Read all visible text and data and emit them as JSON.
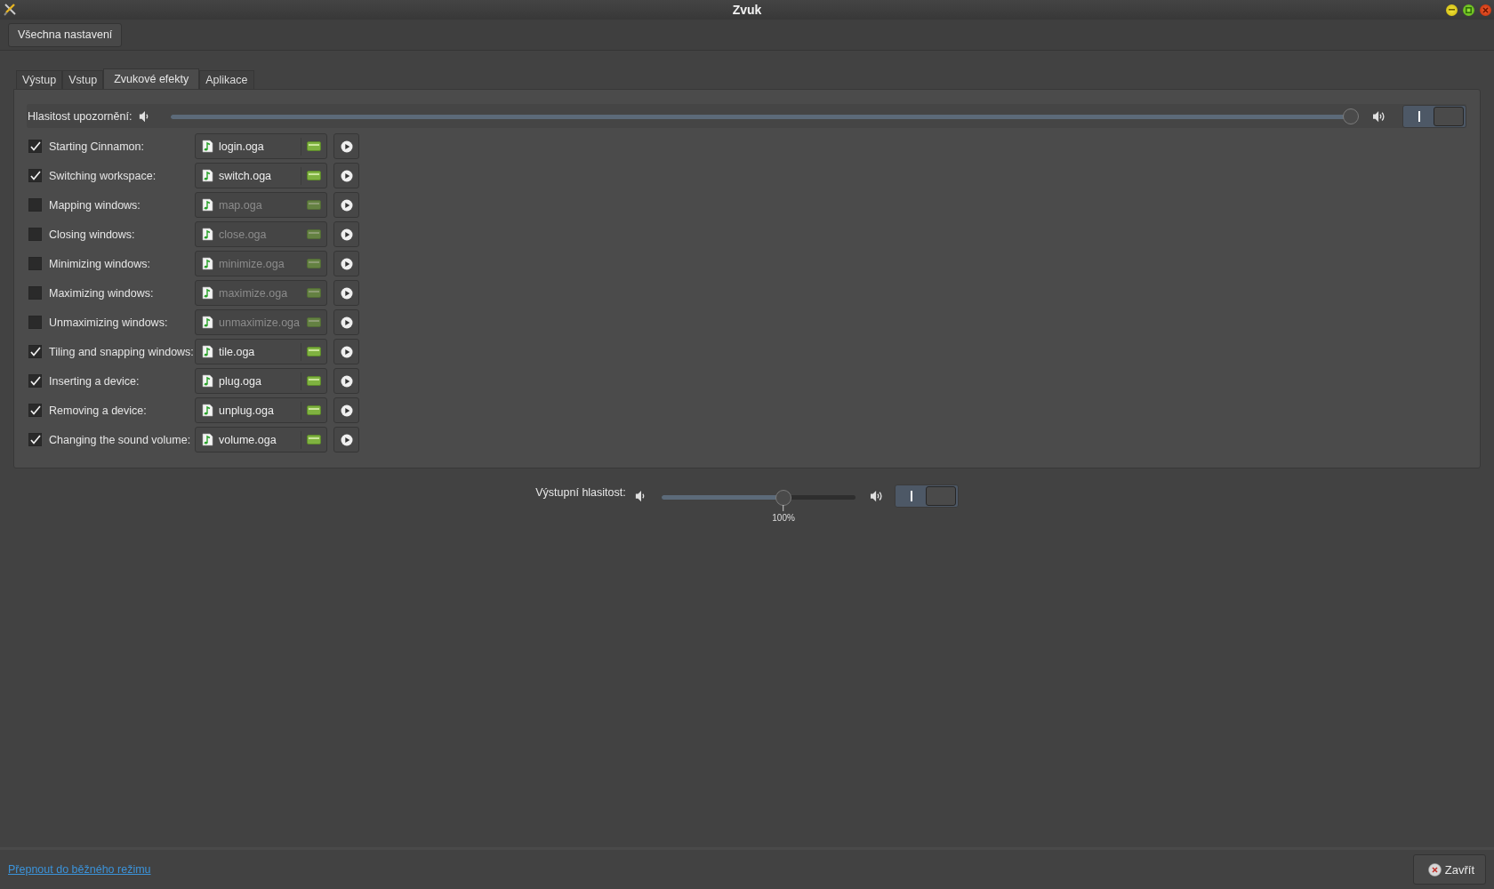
{
  "window": {
    "title": "Zvuk"
  },
  "header": {
    "button": "Všechna nastavení"
  },
  "tabs": [
    {
      "label": "Výstup",
      "selected": false
    },
    {
      "label": "Vstup",
      "selected": false
    },
    {
      "label": "Zvukové efekty",
      "selected": true
    },
    {
      "label": "Aplikace",
      "selected": false
    }
  ],
  "notification_volume": {
    "label": "Hlasitost upozornění:",
    "level": 1.0,
    "on": true
  },
  "effects": [
    {
      "label": "Starting Cinnamon:",
      "checked": true,
      "file": "login.oga"
    },
    {
      "label": "Switching workspace:",
      "checked": true,
      "file": "switch.oga"
    },
    {
      "label": "Mapping windows:",
      "checked": false,
      "file": "map.oga"
    },
    {
      "label": "Closing windows:",
      "checked": false,
      "file": "close.oga"
    },
    {
      "label": "Minimizing windows:",
      "checked": false,
      "file": "minimize.oga"
    },
    {
      "label": "Maximizing windows:",
      "checked": false,
      "file": "maximize.oga"
    },
    {
      "label": "Unmaximizing windows:",
      "checked": false,
      "file": "unmaximize.oga"
    },
    {
      "label": "Tiling and snapping windows:",
      "checked": true,
      "file": "tile.oga"
    },
    {
      "label": "Inserting a device:",
      "checked": true,
      "file": "plug.oga"
    },
    {
      "label": "Removing a device:",
      "checked": true,
      "file": "unplug.oga"
    },
    {
      "label": "Changing the sound volume:",
      "checked": true,
      "file": "volume.oga"
    }
  ],
  "output_volume": {
    "label": "Výstupní hlasitost:",
    "level": 0.63,
    "mark": "100%",
    "on": true
  },
  "footer": {
    "link": "Přepnout do běžného režimu",
    "close_button": "Zavřít"
  }
}
